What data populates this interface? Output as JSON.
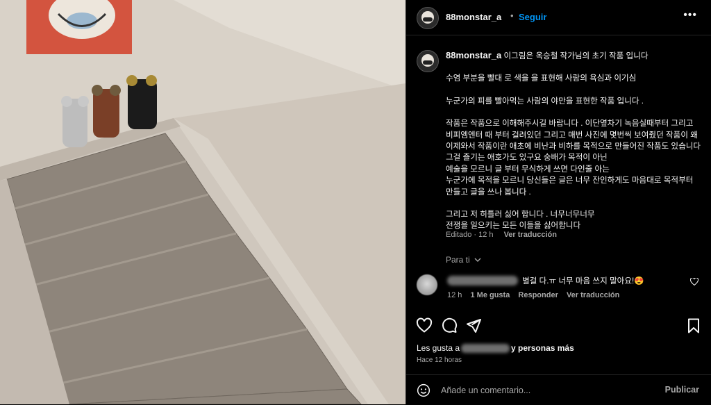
{
  "post": {
    "username": "88monstar_a",
    "separator": "•",
    "follow_label": "Seguir",
    "more_icon": "more-horizontal-icon",
    "more_label": "•••"
  },
  "caption": {
    "username": "88monstar_a",
    "lines": [
      "이그림은 옥승철 작가님의 초기 작품 입니다",
      "수염 부분을 빨대 로 색을 을 표현해 사람의 욕심과 이기심",
      "누군가의 피를 빨아먹는 사람의 야만을 표현한 작품 입니다 .",
      "작품은 작품으로 이해해주시길 바랍니다 . 이단옆차기 녹음실때부터 그리고",
      "비피엠엔터 때 부터 걸려있던 그리고 매번 사진에 몇번씩 보여줬던 작품이 왜",
      "이제와서 작품이란 애초에 비난과 비하를 목적으로 만들어진 작품도 있습니다",
      "그걸 즐기는 애호가도 있구요 숭배가 목적이 아닌",
      "예술을 모르니 글 부터 무식하게 쓰면 다인줄 아는",
      "누군가에 목적을 모르니 당신들은 글은 너무 잔인하게도 마음대로 목적부터",
      "만들고 글을 쓰나 봅니다 .",
      "그리고 저 히틀러 싫어 합니다 . 너무너무너무",
      "전쟁을 일으키는 모든 이들을 싫어합니다"
    ],
    "edited_label": "Editado · 12 h",
    "translate_label": "Ver traducción"
  },
  "comments_filter": {
    "label": "Para ti",
    "icon": "chevron-down-icon"
  },
  "comment": {
    "text": "별걸 다.ㅠ 너무 마음 쓰지 말아요!😍",
    "time": "12 h",
    "likes": "1 Me gusta",
    "reply_label": "Responder",
    "translate_label": "Ver traducción"
  },
  "actions": {
    "like_icon": "heart-icon",
    "comment_icon": "comment-icon",
    "share_icon": "send-icon",
    "save_icon": "bookmark-icon"
  },
  "likes": {
    "prefix": "Les gusta a",
    "suffix": "y personas más"
  },
  "timestamp": "Hace 12 horas",
  "composer": {
    "placeholder": "Añade un comentario...",
    "post_label": "Publicar",
    "emoji_icon": "emoji-icon"
  },
  "colors": {
    "background": "#000000",
    "text": "#f5f5f5",
    "secondary": "#a8a8a8",
    "accent": "#0095f6",
    "divider": "#262626"
  }
}
